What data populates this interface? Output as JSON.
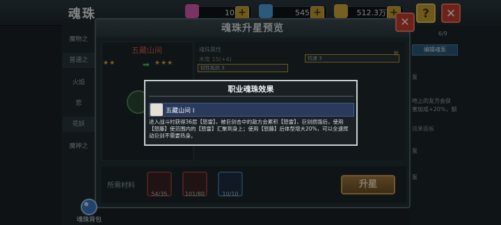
{
  "header": {
    "title": "魂珠"
  },
  "resources": [
    {
      "icon": "gem-pink-icon",
      "value": "10",
      "color": "#e05fb3"
    },
    {
      "icon": "diamond-blue-icon",
      "value": "545",
      "color": "#4fa4e0"
    },
    {
      "icon": "gold-chest-icon",
      "value": "512.3万",
      "color": "#d6b03a"
    }
  ],
  "left_tabs": [
    "魔物之",
    "普通之",
    "火焰",
    "悲",
    "花妖",
    "魔神之"
  ],
  "right_panel": {
    "count": "6/9",
    "button": "编辑魂泵",
    "line1": "地上的友方会获",
    "line2": "害加成+20%，额",
    "note": "效果面板",
    "label_a": "泵",
    "label_b": "泵",
    "label_c": "泵"
  },
  "dialog": {
    "title": "魂珠升星预览",
    "orb_name": "五藏山间",
    "stars_before": "★★",
    "stars_after": "★★★",
    "attr_header": "魂珠属性",
    "attr_line1": "木攻 15(+4)",
    "attr_line2": "韧性抵抗 3",
    "attr_line3": "抗速 3",
    "tag": "新",
    "materials_label": "所需材料",
    "materials": [
      {
        "count": "54/35",
        "icon": "red-crystal-pouch-icon"
      },
      {
        "count": "101/80",
        "icon": "red-crystal-icon"
      },
      {
        "count": "10/10",
        "icon": "blue-jar-icon"
      }
    ],
    "upgrade_button": "升星"
  },
  "popup": {
    "title": "职业魂珠效果",
    "orb_entry": "五藏山间 Ⅰ",
    "description": "进入战斗时获得36层【怒雷】，被巨剑击中的敌方会累积【怒雷】，巨剑损毁后，使用【怒藤】使范围内的【怒雷】汇聚到身上；使用【怒藤】后体型增大20%，可以全速挥动巨剑不需要热身。"
  },
  "bag": {
    "label": "魂珠背包"
  }
}
